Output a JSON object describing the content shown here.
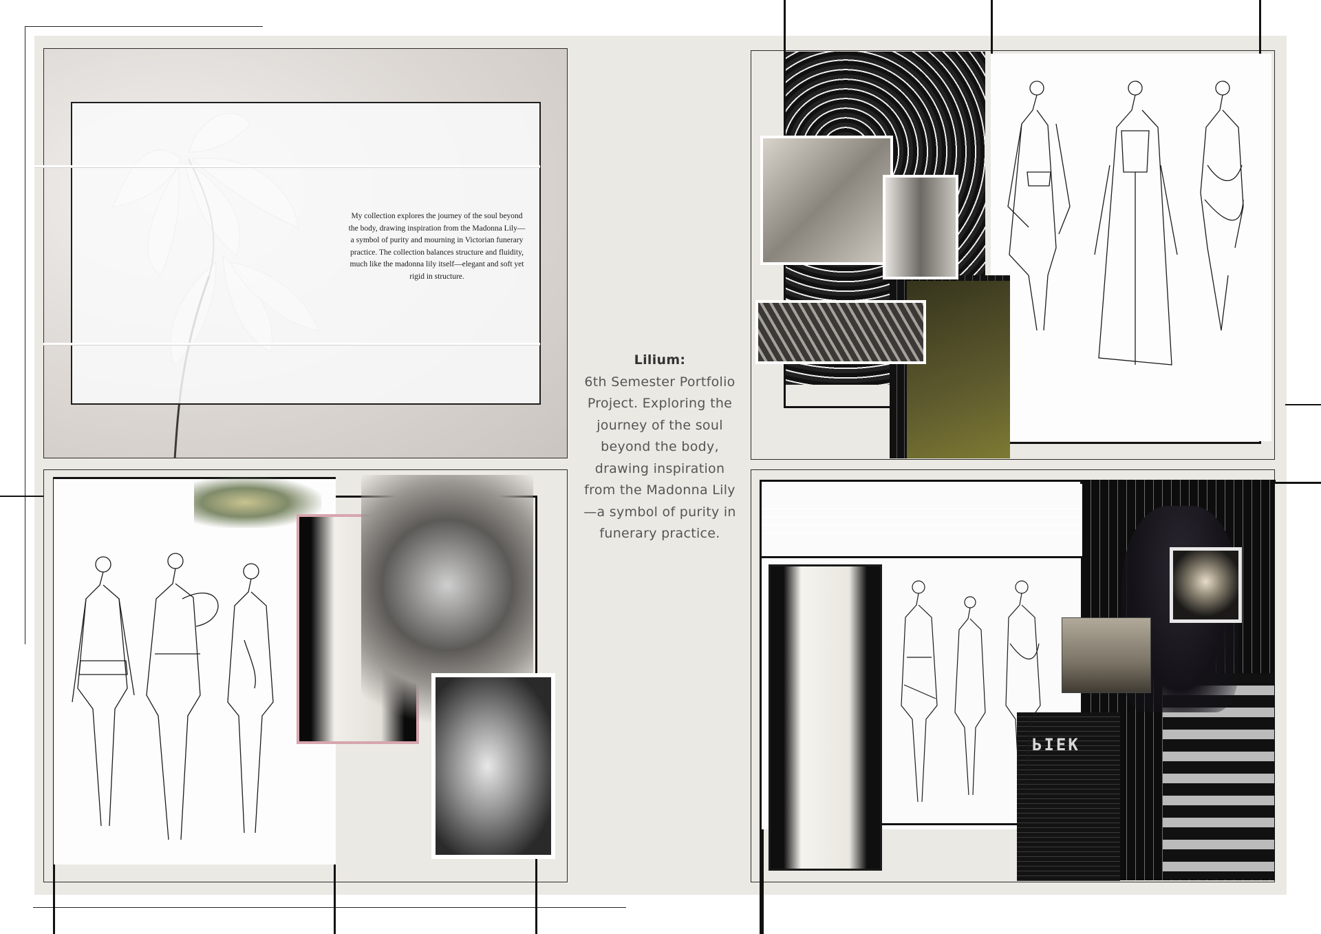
{
  "intro": {
    "text": "My collection explores the journey of the soul beyond the body, drawing inspiration from the Madonna Lily—a symbol of purity and mourning in Victorian funerary practice. The collection balances structure and fluidity, much like the madonna lily itself—elegant and soft yet rigid in structure."
  },
  "caption": {
    "title": "Lilium:",
    "body": "6th Semester Portfolio Project. Exploring the journey of the soul beyond the body, drawing inspiration from the Madonna Lily—a symbol of purity in funerary practice."
  },
  "textile": {
    "label": "ЬIEK"
  },
  "colors": {
    "board": "#ebe9e4",
    "ink": "#111111",
    "olive": "#5e5a2e",
    "pink_frame": "#d7a5ae"
  }
}
